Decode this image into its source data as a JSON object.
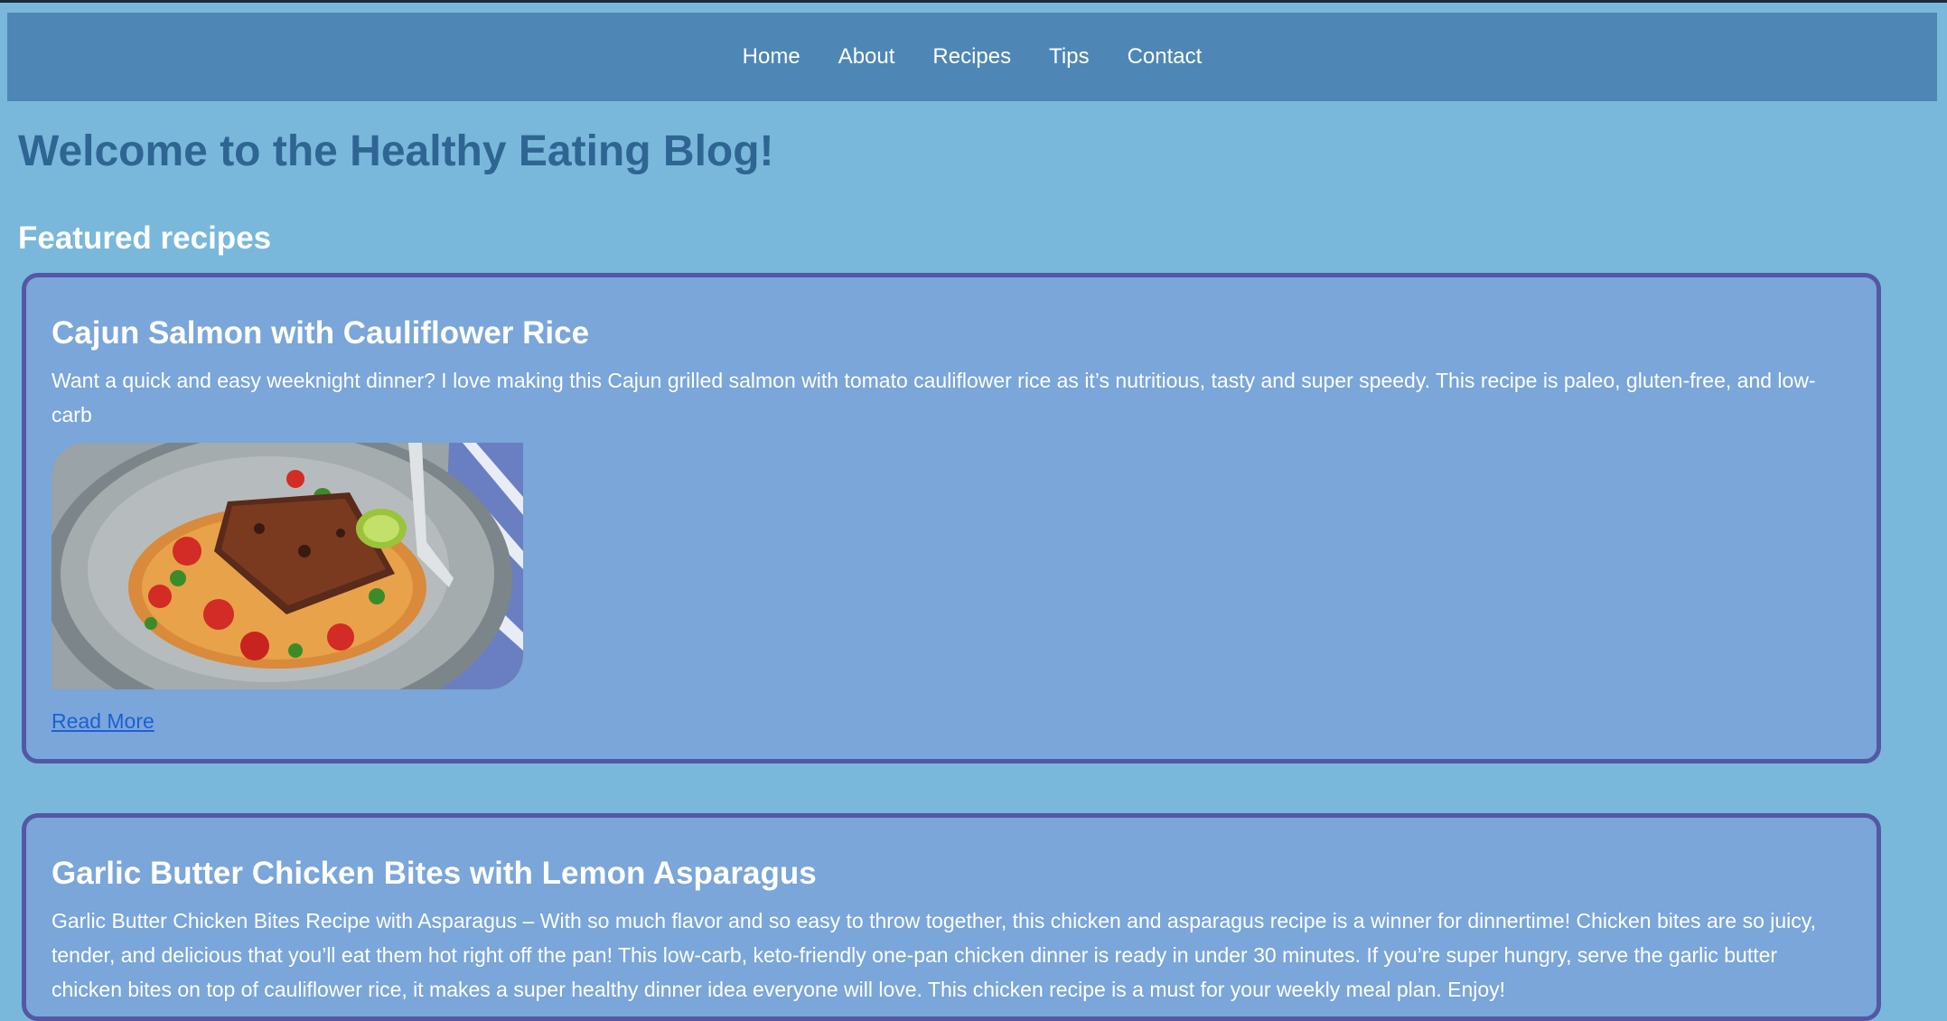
{
  "nav": {
    "items": [
      "Home",
      "About",
      "Recipes",
      "Tips",
      "Contact"
    ]
  },
  "page_title": "Welcome to the Healthy Eating Blog!",
  "section_title": "Featured recipes",
  "recipes": [
    {
      "title": "Cajun Salmon with Cauliflower Rice",
      "description": "Want a quick and easy weeknight dinner? I love making this Cajun grilled salmon with tomato cauliflower rice as it’s nutritious, tasty and super speedy. This recipe is paleo, gluten-free, and low-carb",
      "link_label": "Read More"
    },
    {
      "title": "Garlic Butter Chicken Bites with Lemon Asparagus",
      "description": "Garlic Butter Chicken Bites Recipe with Asparagus – With so much flavor and so easy to throw together, this chicken and asparagus recipe is a winner for dinnertime! Chicken bites are so juicy, tender, and delicious that you’ll eat them hot right off the pan! This low-carb, keto-friendly one-pan chicken dinner is ready in under 30 minutes. If you’re super hungry, serve the garlic butter chicken bites on top of cauliflower rice, it makes a super healthy dinner idea everyone will love. This chicken recipe is a must for your weekly meal plan. Enjoy!"
    }
  ],
  "colors": {
    "page_bg": "#79b8da",
    "nav_bg": "#4e87b5",
    "card_bg": "#7aa6d9",
    "card_border": "#5458a4",
    "title_blue": "#2f6593",
    "link_blue": "#1e5fd6"
  }
}
